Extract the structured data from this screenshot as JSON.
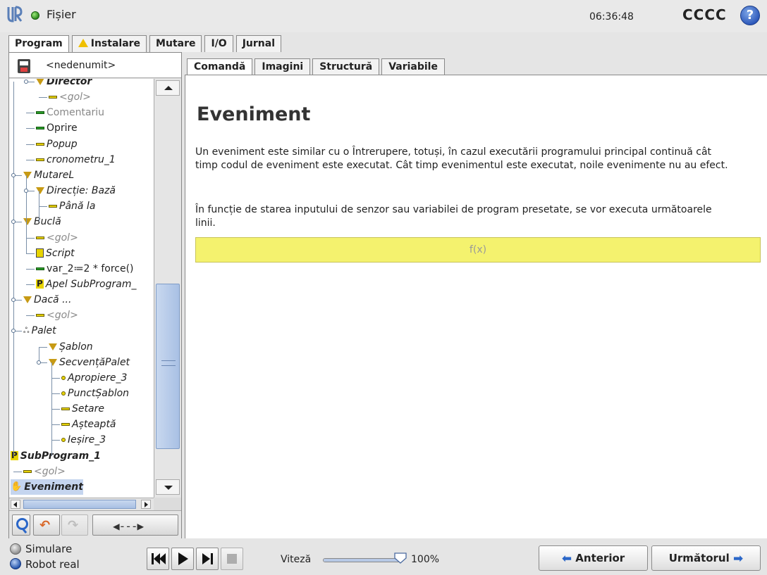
{
  "header": {
    "menu_label": "Fișier",
    "clock": "06:36:48",
    "robot_name": "CCCC",
    "help": "?"
  },
  "main_tabs": [
    {
      "label": "Program",
      "active": true
    },
    {
      "label": "Instalare",
      "warning": true
    },
    {
      "label": "Mutare"
    },
    {
      "label": "I/O"
    },
    {
      "label": "Jurnal"
    }
  ],
  "program": {
    "name": "<nedenumit>"
  },
  "tree": [
    {
      "label": "Director",
      "icon": "triangle-icon",
      "style": "bold-italic"
    },
    {
      "label": "<gol>",
      "icon": "yellow-bar-icon",
      "style": "gray"
    },
    {
      "label": "Comentariu",
      "icon": "green-bar-icon",
      "style": "gray-plain"
    },
    {
      "label": "Oprire",
      "icon": "green-bar-icon",
      "style": "plain"
    },
    {
      "label": "Popup",
      "icon": "yellow-bar-icon",
      "style": "italic"
    },
    {
      "label": "cronometru_1",
      "icon": "yellow-bar-icon",
      "style": "italic"
    },
    {
      "label": "MutareL",
      "icon": "triangle-icon",
      "style": "italic"
    },
    {
      "label": "Direcție: Bază",
      "icon": "triangle-icon",
      "style": "italic"
    },
    {
      "label": "Până la",
      "icon": "yellow-bar-icon",
      "style": "italic"
    },
    {
      "label": "Buclă",
      "icon": "triangle-icon",
      "style": "italic"
    },
    {
      "label": "<gol>",
      "icon": "yellow-bar-icon",
      "style": "gray"
    },
    {
      "label": "Script",
      "icon": "script-icon",
      "style": "italic"
    },
    {
      "label": "var_2≔2 * force()",
      "icon": "green-bar-icon",
      "style": "plain"
    },
    {
      "label": "Apel SubProgram_",
      "icon": "subprogram-icon",
      "style": "italic"
    },
    {
      "label": "Dacă ...",
      "icon": "triangle-icon",
      "style": "italic"
    },
    {
      "label": "<gol>",
      "icon": "yellow-bar-icon",
      "style": "gray"
    },
    {
      "label": "Palet",
      "icon": "pallet-icon",
      "style": "italic"
    },
    {
      "label": "Șablon",
      "icon": "triangle-icon",
      "style": "italic"
    },
    {
      "label": "SecvențăPalet",
      "icon": "triangle-icon",
      "style": "italic"
    },
    {
      "label": "Apropiere_3",
      "icon": "waypoint-icon",
      "style": "italic"
    },
    {
      "label": "PunctȘablon",
      "icon": "waypoint-icon",
      "style": "italic"
    },
    {
      "label": "Setare",
      "icon": "yellow-bar-icon",
      "style": "italic"
    },
    {
      "label": "Așteaptă",
      "icon": "yellow-bar-icon",
      "style": "italic"
    },
    {
      "label": "Ieșire_3",
      "icon": "waypoint-icon",
      "style": "italic"
    },
    {
      "label": "SubProgram_1",
      "icon": "subprogram-icon",
      "style": "bold-italic"
    },
    {
      "label": "<gol>",
      "icon": "yellow-bar-icon",
      "style": "gray"
    },
    {
      "label": "Eveniment",
      "icon": "event-icon",
      "style": "bold-italic",
      "selected": true
    }
  ],
  "sub_tabs": [
    {
      "label": "Comandă",
      "active": true
    },
    {
      "label": "Imagini"
    },
    {
      "label": "Structură"
    },
    {
      "label": "Variabile"
    }
  ],
  "content": {
    "title": "Eveniment",
    "desc1": "Un eveniment este similar cu o Întrerupere, totuși, în cazul executării programului principal continuă cât timp codul de eveniment este executat. Cât timp evenimentul este executat, noile evenimente nu au efect.",
    "desc2": "În funcție de starea inputului de senzor sau variabilei de program presetate, se vor executa următoarele linii.",
    "expression_placeholder": "f(x)"
  },
  "bottom": {
    "simulation_label": "Simulare",
    "real_robot_label": "Robot real",
    "speed_label": "Viteză",
    "speed_value": "100%",
    "speed_fraction": 1.0,
    "prev_label": "Anterior",
    "next_label": "Următorul"
  },
  "colors": {
    "expression_bg": "#f4f26e",
    "accent_blue": "#2a66c8",
    "selection": "#c5d5ef"
  }
}
